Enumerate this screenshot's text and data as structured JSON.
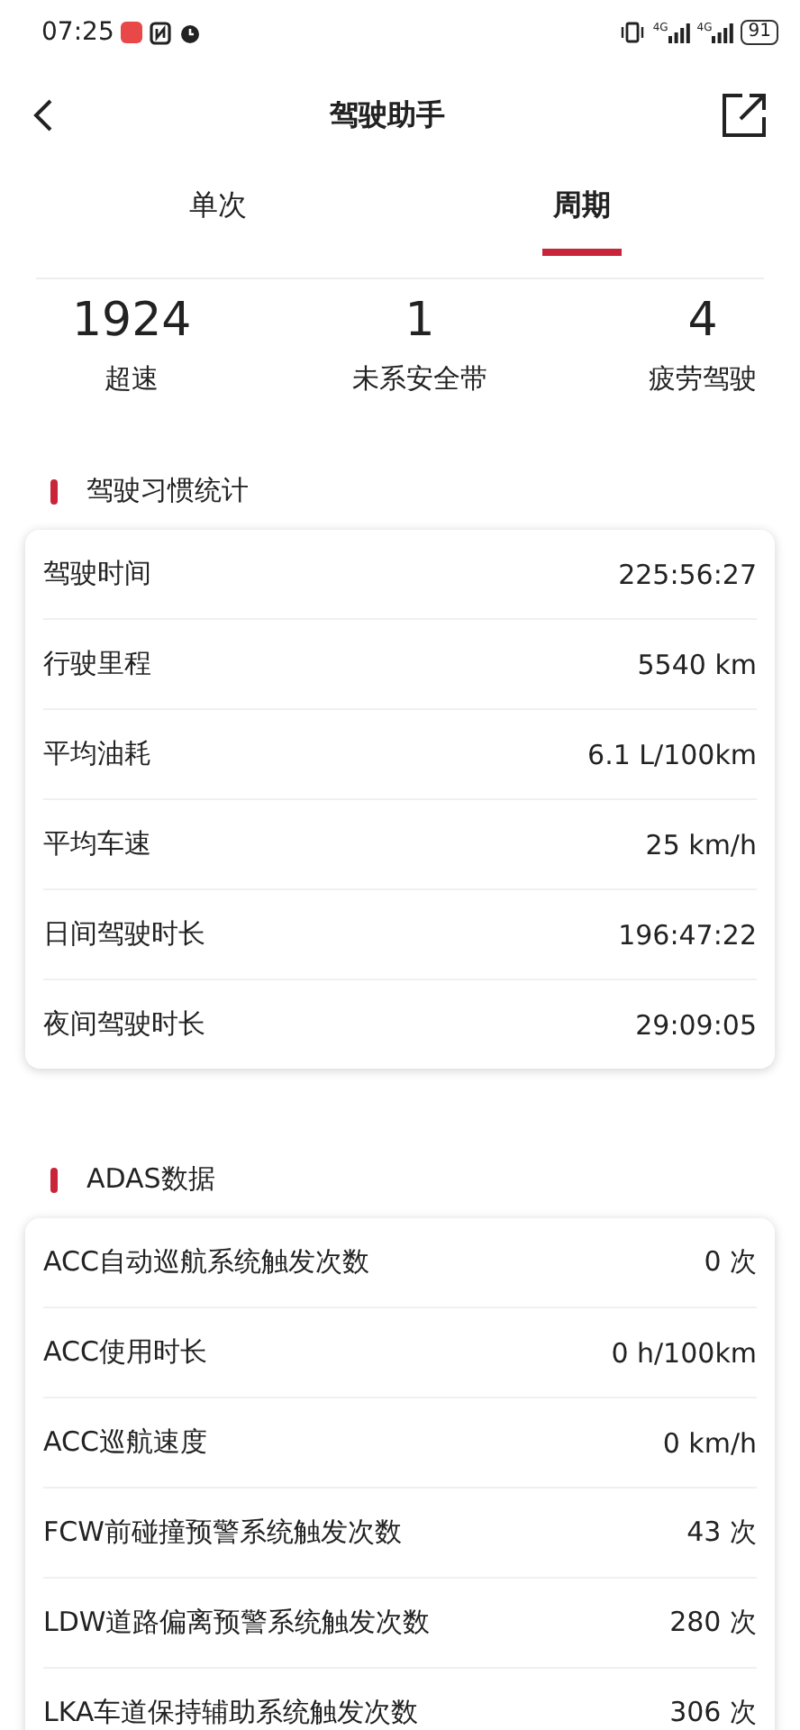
{
  "status_bar": {
    "time": "07:25",
    "networks": [
      "4G",
      "4G"
    ],
    "battery": "91"
  },
  "header": {
    "title": "驾驶助手"
  },
  "tabs": [
    {
      "label": "单次",
      "selected": false
    },
    {
      "label": "周期",
      "selected": true
    }
  ],
  "summary": [
    {
      "value": "1924",
      "label": "超速"
    },
    {
      "value": "1",
      "label": "未系安全带"
    },
    {
      "value": "4",
      "label": "疲劳驾驶"
    }
  ],
  "sections": [
    {
      "title": "驾驶习惯统计",
      "rows": [
        {
          "label": "驾驶时间",
          "value": "225:56:27"
        },
        {
          "label": "行驶里程",
          "value": "5540 km"
        },
        {
          "label": "平均油耗",
          "value": "6.1 L/100km"
        },
        {
          "label": "平均车速",
          "value": "25 km/h"
        },
        {
          "label": "日间驾驶时长",
          "value": "196:47:22"
        },
        {
          "label": "夜间驾驶时长",
          "value": "29:09:05"
        }
      ]
    },
    {
      "title": "ADAS数据",
      "rows": [
        {
          "label": "ACC自动巡航系统触发次数",
          "value": "0 次"
        },
        {
          "label": "ACC使用时长",
          "value": "0 h/100km"
        },
        {
          "label": "ACC巡航速度",
          "value": "0 km/h"
        },
        {
          "label": "FCW前碰撞预警系统触发次数",
          "value": "43 次"
        },
        {
          "label": "LDW道路偏离预警系统触发次数",
          "value": "280 次"
        },
        {
          "label": "LKA车道保持辅助系统触发次数",
          "value": "306 次"
        }
      ]
    }
  ]
}
